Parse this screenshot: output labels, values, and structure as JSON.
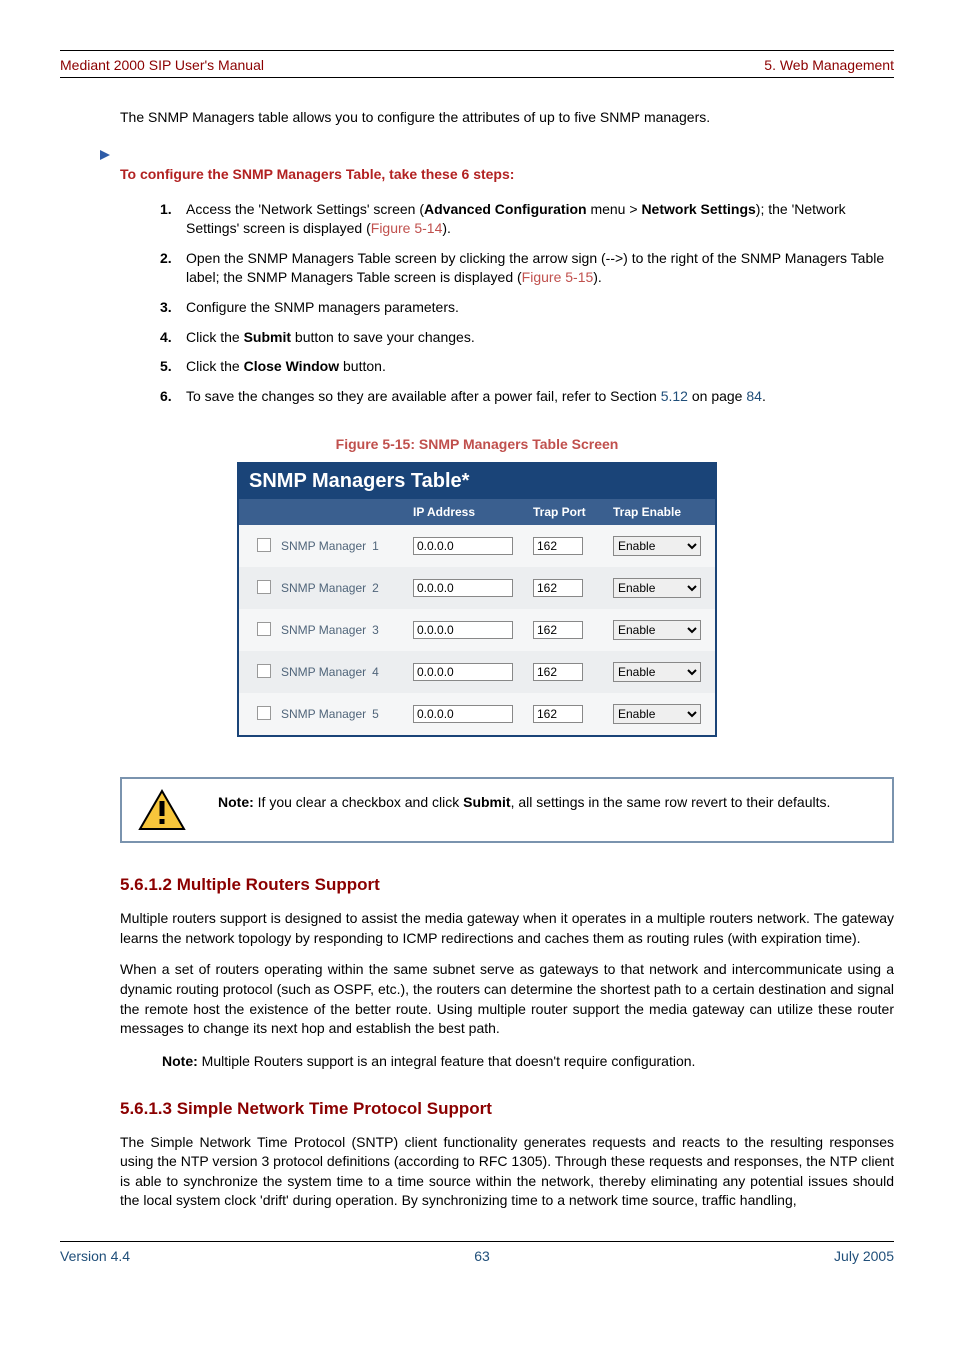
{
  "header": {
    "left": "Mediant 2000 SIP User's Manual",
    "right": "5. Web Management"
  },
  "intro_para": "The SNMP Managers table allows you to configure the attributes of up to five SNMP managers.",
  "proc_lead": "To configure the SNMP Managers Table, take these 6 steps:",
  "steps": {
    "s1_a": "Access the 'Network Settings' screen (",
    "s1_b": "Advanced Configuration",
    "s1_c": " menu > ",
    "s1_d": "Network Settings",
    "s1_e": "); the 'Network Settings' screen is displayed (",
    "s1_f": "Figure 5-14",
    "s1_g": ").",
    "s2_a": "Open the SNMP Managers Table screen by clicking the arrow sign (-->) to the right of the SNMP Managers Table label; the SNMP Managers Table screen is displayed (",
    "s2_b": "Figure 5-15",
    "s2_c": ").",
    "s3": "Configure the SNMP managers parameters.",
    "s4_a": "Click the ",
    "s4_b": "Submit",
    "s4_c": " button to save your changes.",
    "s5_a": "Click the ",
    "s5_b": "Close Window",
    "s5_c": " button.",
    "s6_a": "To save the changes so they are available after a power fail, refer to Section ",
    "s6_b": "5.12",
    "s6_c": " on page ",
    "s6_d": "84",
    "s6_e": ".",
    "n1": "1.",
    "n2": "2.",
    "n3": "3.",
    "n4": "4.",
    "n5": "5.",
    "n6": "6."
  },
  "figure_caption": "Figure 5-15: SNMP Managers Table Screen",
  "table": {
    "title": "SNMP Managers Table*",
    "col_ip": "IP Address",
    "col_port": "Trap Port",
    "col_enable": "Trap Enable",
    "rows": [
      {
        "name": "SNMP Manager",
        "num": "1",
        "ip": "0.0.0.0",
        "port": "162",
        "enable": "Enable"
      },
      {
        "name": "SNMP Manager",
        "num": "2",
        "ip": "0.0.0.0",
        "port": "162",
        "enable": "Enable"
      },
      {
        "name": "SNMP Manager",
        "num": "3",
        "ip": "0.0.0.0",
        "port": "162",
        "enable": "Enable"
      },
      {
        "name": "SNMP Manager",
        "num": "4",
        "ip": "0.0.0.0",
        "port": "162",
        "enable": "Enable"
      },
      {
        "name": "SNMP Manager",
        "num": "5",
        "ip": "0.0.0.0",
        "port": "162",
        "enable": "Enable"
      }
    ]
  },
  "note": {
    "label": "Note:",
    "text_a": " If you clear a checkbox and click ",
    "text_b": "Submit",
    "text_c": ", all settings in the same row revert to their defaults."
  },
  "sec_mr": {
    "heading": "5.6.1.2  Multiple Routers Support",
    "p1": "Multiple routers support is designed to assist the media gateway when it operates in a multiple routers network. The gateway learns the network topology by responding to ICMP redirections and caches them as routing rules (with expiration time).",
    "p2": "When a set of routers operating within the same subnet serve as gateways to that network and intercommunicate using a dynamic routing protocol (such as OSPF, etc.), the routers can determine the shortest path to a certain destination and signal the remote host the existence of the better route. Using multiple router support the media gateway can utilize these router messages to change its next hop and establish the best path.",
    "subnote_a": "Note:",
    "subnote_b": " Multiple Routers support is an integral feature that doesn't require configuration."
  },
  "sec_sntp": {
    "heading": "5.6.1.3  Simple Network Time Protocol Support",
    "p1": "The Simple Network Time Protocol (SNTP) client functionality generates requests and reacts to the resulting responses using the NTP version 3 protocol definitions (according to RFC 1305). Through these requests and responses, the NTP client is able to synchronize the system time to a time source within the network, thereby eliminating any potential issues should the local system clock 'drift' during operation. By synchronizing time to a network time source, traffic handling,"
  },
  "footer": {
    "left": "Version 4.4",
    "center": "63",
    "right": "July 2005"
  }
}
